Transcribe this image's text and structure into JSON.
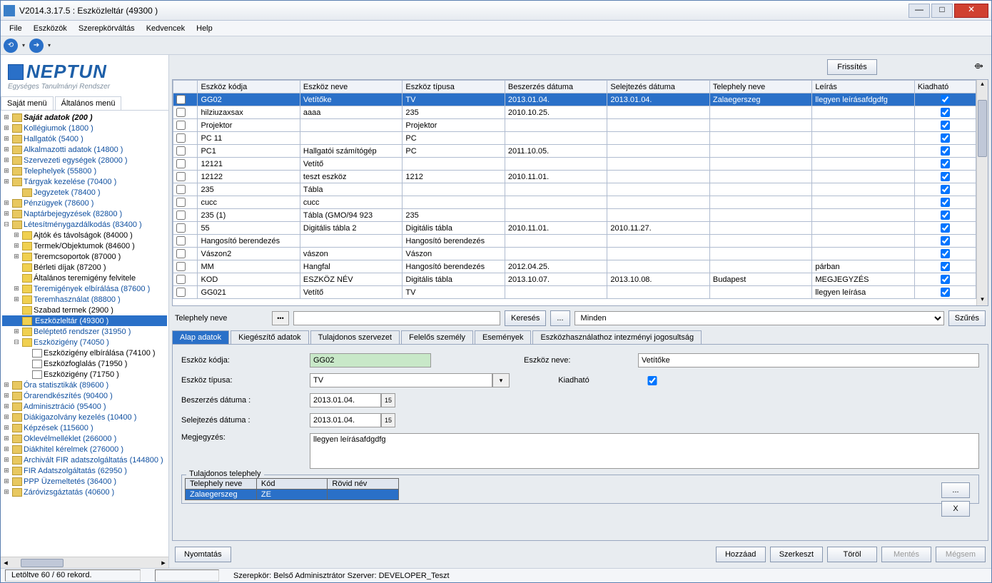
{
  "window": {
    "title": "V2014.3.17.5 : Eszközleltár (49300  )"
  },
  "menu": [
    "File",
    "Eszközök",
    "Szerepkörváltás",
    "Kedvencek",
    "Help"
  ],
  "logo": {
    "text": "NEPTUN",
    "sub": "Egységes Tanulmányi Rendszer"
  },
  "side_tabs": [
    "Saját menü",
    "Általános menü"
  ],
  "tree": [
    {
      "lvl": 0,
      "exp": "+",
      "icon": "folder",
      "txt": "Saját adatok (200  )",
      "cls": "bold"
    },
    {
      "lvl": 0,
      "exp": "+",
      "icon": "folder",
      "txt": "Kollégiumok (1800  )",
      "cls": ""
    },
    {
      "lvl": 0,
      "exp": "+",
      "icon": "folder",
      "txt": "Hallgatók (5400  )",
      "cls": ""
    },
    {
      "lvl": 0,
      "exp": "+",
      "icon": "folder",
      "txt": "Alkalmazotti adatok (14800  )",
      "cls": ""
    },
    {
      "lvl": 0,
      "exp": "+",
      "icon": "folder",
      "txt": "Szervezeti egységek (28000  )",
      "cls": ""
    },
    {
      "lvl": 0,
      "exp": "+",
      "icon": "folder",
      "txt": "Telephelyek (55800  )",
      "cls": ""
    },
    {
      "lvl": 0,
      "exp": "+",
      "icon": "folder",
      "txt": "Tárgyak kezelése (70400  )",
      "cls": "blue"
    },
    {
      "lvl": 1,
      "exp": "",
      "icon": "folder",
      "txt": "Jegyzetek (78400  )",
      "cls": ""
    },
    {
      "lvl": 0,
      "exp": "+",
      "icon": "folder",
      "txt": "Pénzügyek (78600  )",
      "cls": "blue"
    },
    {
      "lvl": 0,
      "exp": "+",
      "icon": "folder",
      "txt": "Naptárbejegyzések (82800  )",
      "cls": "blue"
    },
    {
      "lvl": 0,
      "exp": "−",
      "icon": "folder",
      "txt": "Létesítménygazdálkodás (83400  )",
      "cls": "blue"
    },
    {
      "lvl": 1,
      "exp": "+",
      "icon": "yfolder",
      "txt": "Ajtók és távolságok (84000  )",
      "cls": "black"
    },
    {
      "lvl": 1,
      "exp": "+",
      "icon": "yfolder",
      "txt": "Termek/Objektumok (84600  )",
      "cls": "black"
    },
    {
      "lvl": 1,
      "exp": "+",
      "icon": "yfolder",
      "txt": "Teremcsoportok (87000  )",
      "cls": "black"
    },
    {
      "lvl": 1,
      "exp": "",
      "icon": "yfolder",
      "txt": "Bérleti díjak (87200  )",
      "cls": "black"
    },
    {
      "lvl": 1,
      "exp": "",
      "icon": "yfolder",
      "txt": "Általános teremigény felvitele",
      "cls": "black"
    },
    {
      "lvl": 1,
      "exp": "+",
      "icon": "yfolder",
      "txt": "Teremigények elbírálása (87600  )",
      "cls": "blue"
    },
    {
      "lvl": 1,
      "exp": "+",
      "icon": "yfolder",
      "txt": "Teremhasználat (88800  )",
      "cls": "blue"
    },
    {
      "lvl": 1,
      "exp": "",
      "icon": "yfolder",
      "txt": "Szabad termek (2900  )",
      "cls": "black"
    },
    {
      "lvl": 1,
      "exp": "",
      "icon": "yfolder",
      "txt": "Eszközleltár (49300  )",
      "cls": "black",
      "sel": true
    },
    {
      "lvl": 1,
      "exp": "+",
      "icon": "yfolder",
      "txt": "Beléptető rendszer (31950  )",
      "cls": "blue"
    },
    {
      "lvl": 1,
      "exp": "−",
      "icon": "yfolder",
      "txt": "Eszközigény (74050  )",
      "cls": "blue"
    },
    {
      "lvl": 2,
      "exp": "",
      "icon": "doc",
      "txt": "Eszközigény elbírálása (74100  )",
      "cls": "black"
    },
    {
      "lvl": 2,
      "exp": "",
      "icon": "doc",
      "txt": "Eszközfoglalás (71950  )",
      "cls": "black"
    },
    {
      "lvl": 2,
      "exp": "",
      "icon": "doc",
      "txt": "Eszközigény (71750  )",
      "cls": "black"
    },
    {
      "lvl": 0,
      "exp": "+",
      "icon": "folder",
      "txt": "Óra statisztikák (89600  )",
      "cls": "blue"
    },
    {
      "lvl": 0,
      "exp": "+",
      "icon": "folder",
      "txt": "Órarendkészítés (90400  )",
      "cls": "blue"
    },
    {
      "lvl": 0,
      "exp": "+",
      "icon": "folder",
      "txt": "Adminisztráció (95400  )",
      "cls": "blue"
    },
    {
      "lvl": 0,
      "exp": "+",
      "icon": "folder",
      "txt": "Diákigazolvány kezelés (10400  )",
      "cls": "blue"
    },
    {
      "lvl": 0,
      "exp": "+",
      "icon": "folder",
      "txt": "Képzések (115600  )",
      "cls": ""
    },
    {
      "lvl": 0,
      "exp": "+",
      "icon": "folder",
      "txt": "Oklevélmelléklet (266000  )",
      "cls": ""
    },
    {
      "lvl": 0,
      "exp": "+",
      "icon": "folder",
      "txt": "Diákhitel kérelmek (276000  )",
      "cls": ""
    },
    {
      "lvl": 0,
      "exp": "+",
      "icon": "folder",
      "txt": "Archivált FIR adatszolgáltatás (144800  )",
      "cls": "blue"
    },
    {
      "lvl": 0,
      "exp": "+",
      "icon": "folder",
      "txt": "FIR Adatszolgáltatás (62950  )",
      "cls": "blue"
    },
    {
      "lvl": 0,
      "exp": "+",
      "icon": "folder",
      "txt": "PPP Üzemeltetés (36400  )",
      "cls": "blue"
    },
    {
      "lvl": 0,
      "exp": "+",
      "icon": "folder",
      "txt": "Záróvizsgáztatás (40600  )",
      "cls": "blue"
    }
  ],
  "refresh_btn": "Frissítés",
  "grid_cols": [
    "Eszköz kódja",
    "Eszköz neve",
    "Eszköz típusa",
    "Beszerzés dátuma",
    "Selejtezés dátuma",
    "Telephely neve",
    "Leírás",
    "Kiadható"
  ],
  "grid_rows": [
    {
      "sel": true,
      "c": [
        "GG02",
        "Vetítőke",
        "TV",
        "2013.01.04.",
        "2013.01.04.",
        "Zalaegerszeg",
        "llegyen leírásafdgdfg"
      ],
      "k": true
    },
    {
      "c": [
        "hilziuzaxsax",
        "aaaa",
        "235",
        "2010.10.25.",
        "",
        "",
        ""
      ],
      "k": true
    },
    {
      "c": [
        "Projektor",
        "",
        "Projektor",
        "",
        "",
        "",
        ""
      ],
      "k": true
    },
    {
      "c": [
        "PC 11",
        "",
        "PC",
        "",
        "",
        "",
        ""
      ],
      "k": true
    },
    {
      "c": [
        "PC1",
        "Hallgatói számítógép",
        "PC",
        "2011.10.05.",
        "",
        "",
        ""
      ],
      "k": true
    },
    {
      "c": [
        "12121",
        "Vetítő",
        "",
        "",
        "",
        "",
        ""
      ],
      "k": true
    },
    {
      "c": [
        "12122",
        "teszt eszköz",
        "1212",
        "2010.11.01.",
        "",
        "",
        ""
      ],
      "k": true
    },
    {
      "c": [
        "235",
        "Tábla",
        "",
        "",
        "",
        "",
        ""
      ],
      "k": true
    },
    {
      "c": [
        "cucc",
        "cucc",
        "",
        "",
        "",
        "",
        ""
      ],
      "k": true
    },
    {
      "c": [
        "235 (1)",
        "Tábla (GMO/94 923",
        "235",
        "",
        "",
        "",
        ""
      ],
      "k": true
    },
    {
      "c": [
        "55",
        "Digitális tábla 2",
        "Digitális tábla",
        "2010.11.01.",
        "2010.11.27.",
        "",
        ""
      ],
      "k": true
    },
    {
      "c": [
        "Hangosító berendezés",
        "",
        "Hangosító berendezés",
        "",
        "",
        "",
        ""
      ],
      "k": true
    },
    {
      "c": [
        "Vászon2",
        "vászon",
        "Vászon",
        "",
        "",
        "",
        ""
      ],
      "k": true
    },
    {
      "c": [
        "MM",
        "Hangfal",
        "Hangosító berendezés",
        "2012.04.25.",
        "",
        "",
        "párban"
      ],
      "k": true
    },
    {
      "c": [
        "KOD",
        "ESZKÖZ NÉV",
        "Digitális tábla",
        "2013.10.07.",
        "2013.10.08.",
        "Budapest",
        "MEGJEGYZÉS"
      ],
      "k": true
    },
    {
      "c": [
        "GG021",
        "Vetítő",
        "TV",
        "",
        "",
        "",
        "llegyen leírása"
      ],
      "k": true
    }
  ],
  "filter": {
    "label": "Telephely neve",
    "search_btn": "Keresés",
    "dots_btn": "...",
    "select_val": "Minden",
    "szures_btn": "Szűrés"
  },
  "detail_tabs": [
    "Alap adatok",
    "Kiegészítő adatok",
    "Tulajdonos szervezet",
    "Felelős személy",
    "Események",
    "Eszközhasználathoz intezményi jogosultság"
  ],
  "form": {
    "kodja_lbl": "Eszköz kódja:",
    "kodja_val": "GG02",
    "neve_lbl": "Eszköz neve:",
    "neve_val": "Vetítőke",
    "tipusa_lbl": "Eszköz típusa:",
    "tipusa_val": "TV",
    "kiadhato_lbl": "Kiadható",
    "beszerzes_lbl": "Beszerzés dátuma :",
    "beszerzes_val": "2013.01.04.",
    "selejtezes_lbl": "Selejtezés dátuma :",
    "selejtezes_val": "2013.01.04.",
    "megjegyzes_lbl": "Megjegyzés:",
    "megjegyzes_val": "llegyen leírásafdgdfg"
  },
  "owner": {
    "legend": "Tulajdonos telephely",
    "cols": [
      "Telephely neve",
      "Kód",
      "Rövid név"
    ],
    "row": [
      "Zalaegerszeg",
      "ZE",
      ""
    ],
    "btn_dots": "...",
    "btn_x": "X"
  },
  "bottom_btns": {
    "nyomtatas": "Nyomtatás",
    "hozzaad": "Hozzáad",
    "szerkeszt": "Szerkeszt",
    "torol": "Töröl",
    "mentes": "Mentés",
    "megsem": "Mégsem"
  },
  "status": {
    "left": "Letöltve 60 / 60 rekord.",
    "right": "Szerepkör: Belső Adminisztrátor   Szerver: DEVELOPER_Teszt"
  }
}
